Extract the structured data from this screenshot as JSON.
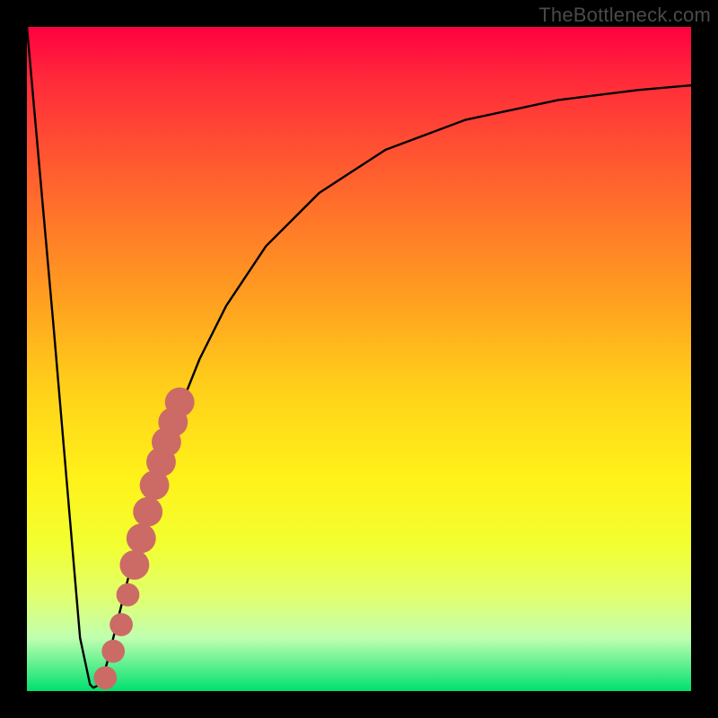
{
  "watermark": "TheBottleneck.com",
  "colors": {
    "frame": "#000000",
    "curve": "#000000",
    "marker_fill": "#cc6b66",
    "marker_stroke": "#b85a55",
    "gradient_stops": [
      {
        "pos": 0.0,
        "hex": "#ff0040"
      },
      {
        "pos": 0.08,
        "hex": "#ff2a3a"
      },
      {
        "pos": 0.18,
        "hex": "#ff5032"
      },
      {
        "pos": 0.3,
        "hex": "#ff7a28"
      },
      {
        "pos": 0.42,
        "hex": "#ffa31f"
      },
      {
        "pos": 0.55,
        "hex": "#ffd21a"
      },
      {
        "pos": 0.68,
        "hex": "#fff21a"
      },
      {
        "pos": 0.78,
        "hex": "#f2ff30"
      },
      {
        "pos": 0.86,
        "hex": "#e0ff70"
      },
      {
        "pos": 0.92,
        "hex": "#c0ffb0"
      },
      {
        "pos": 0.96,
        "hex": "#60f090"
      },
      {
        "pos": 1.0,
        "hex": "#00e070"
      }
    ]
  },
  "chart_data": {
    "type": "line",
    "title": "",
    "xlabel": "",
    "ylabel": "",
    "xlim": [
      0,
      100
    ],
    "ylim": [
      0,
      100
    ],
    "series": [
      {
        "name": "bottleneck-curve",
        "x": [
          0,
          4,
          8,
          9.5,
          10,
          11,
          12,
          13,
          15,
          18,
          22,
          26,
          30,
          36,
          44,
          54,
          66,
          80,
          92,
          100
        ],
        "y": [
          100,
          55,
          8,
          1,
          0.5,
          1,
          4,
          8,
          16,
          28,
          40,
          50,
          58,
          67,
          75,
          81.5,
          86,
          89,
          90.5,
          91.2
        ]
      }
    ],
    "markers": [
      {
        "x": 11.8,
        "y": 2.0,
        "r": 1.0
      },
      {
        "x": 13.0,
        "y": 6.0,
        "r": 1.0
      },
      {
        "x": 14.2,
        "y": 10.0,
        "r": 1.0
      },
      {
        "x": 15.2,
        "y": 14.5,
        "r": 1.0
      },
      {
        "x": 16.2,
        "y": 19.0,
        "r": 1.4
      },
      {
        "x": 17.2,
        "y": 23.0,
        "r": 1.4
      },
      {
        "x": 18.2,
        "y": 27.0,
        "r": 1.4
      },
      {
        "x": 19.2,
        "y": 31.0,
        "r": 1.4
      },
      {
        "x": 20.2,
        "y": 34.5,
        "r": 1.4
      },
      {
        "x": 21.0,
        "y": 37.5,
        "r": 1.4
      },
      {
        "x": 22.0,
        "y": 40.5,
        "r": 1.4
      },
      {
        "x": 23.0,
        "y": 43.5,
        "r": 1.4
      }
    ]
  }
}
